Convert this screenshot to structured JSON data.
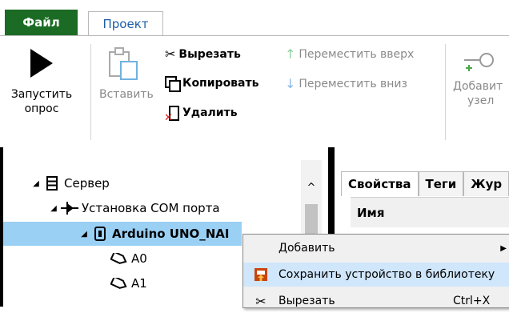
{
  "tabs": {
    "file": "Файл",
    "project": "Проект"
  },
  "ribbon": {
    "run": {
      "line1": "Запустить",
      "line2": "опрос"
    },
    "paste": {
      "label": "Вставить"
    },
    "cut": "Вырезать",
    "copy": "Копировать",
    "delete": "Удалить",
    "move_up": "Переместить вверх",
    "move_down": "Переместить вниз",
    "add_node": {
      "line1": "Добавит",
      "line2": "узел"
    }
  },
  "tree": {
    "server": "Сервер",
    "com_setup": "Установка COM порта",
    "device": "Arduino UNO_NAI",
    "a0": "A0",
    "a1": "A1"
  },
  "right_panel": {
    "tabs": [
      "Свойства",
      "Теги",
      "Жур"
    ],
    "header": "Имя"
  },
  "context_menu": {
    "add": "Добавить",
    "save_to_library": "Сохранить устройство в библиотеку",
    "cut": "Вырезать",
    "cut_shortcut": "Ctrl+X"
  },
  "colors": {
    "file_tab": "#1c6b24",
    "selection": "#9bd0f5",
    "menu_highlight": "#cfe6fb"
  }
}
